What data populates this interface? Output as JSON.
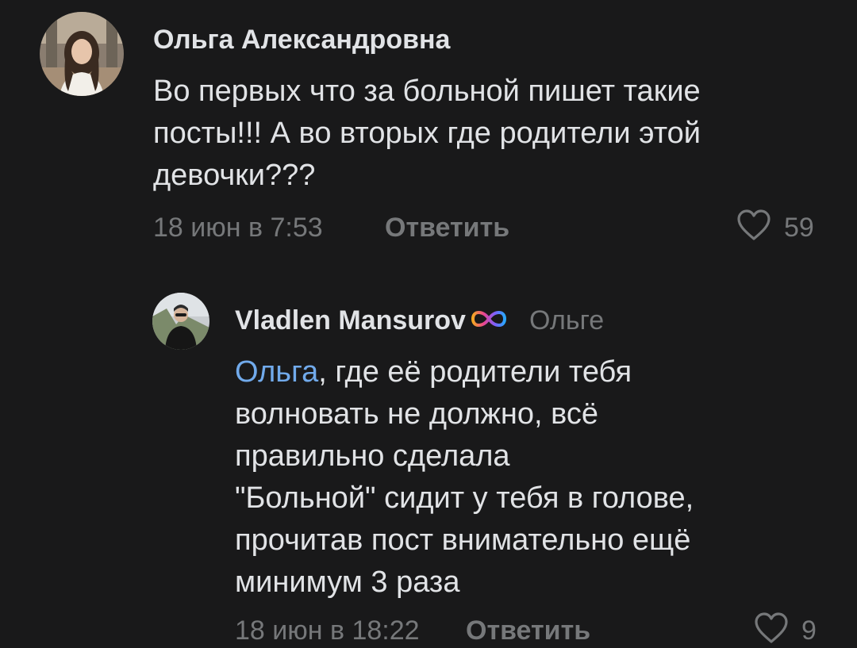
{
  "comments": [
    {
      "author": "Ольга Александровна",
      "text": "Во первых что за больной пишет такие\nпосты!!! А во вторых где родители этой\nдевочки???",
      "time": "18 июн в 7:53",
      "reply_label": "Ответить",
      "like_count": "59",
      "avatar_icon": "user-photo-icon"
    }
  ],
  "reply": {
    "author": "Vladlen Mansurov",
    "reply_to": "Ольге",
    "badge_icon": "infinity-badge-icon",
    "mention": "Ольга",
    "text": ", где её родители тебя\nволновать не должно, всё\nправильно сделала\n\"Больной\" сидит у тебя в голове,\nпрочитав пост внимательно ещё\nминимум 3 раза",
    "time": "18 июн в 18:22",
    "reply_label": "Ответить",
    "like_count": "9",
    "avatar_icon": "user-photo-icon"
  },
  "colors": {
    "background": "#19191a",
    "text": "#e1e3e6",
    "secondary": "#76787a",
    "link": "#71aaeb"
  }
}
